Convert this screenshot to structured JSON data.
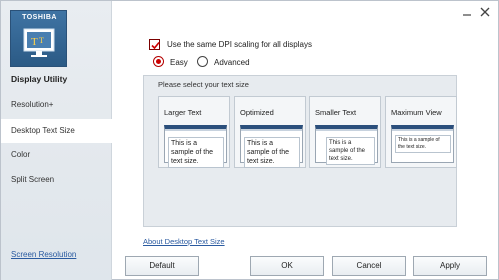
{
  "sidebar": {
    "logo_text": "TOSHIBA",
    "app_name": "Display Utility",
    "items": [
      {
        "label": "Resolution+"
      },
      {
        "label": "Desktop Text Size"
      },
      {
        "label": "Color"
      },
      {
        "label": "Split Screen"
      }
    ],
    "selected_index": 1,
    "footer_link": "Screen Resolution"
  },
  "window": {
    "minimize_icon": "minimize-icon",
    "close_icon": "close-icon"
  },
  "main": {
    "dpi_checkbox": {
      "label": "Use the same DPI scaling for all displays",
      "checked": true
    },
    "mode": {
      "options": [
        {
          "label": "Easy",
          "selected": true
        },
        {
          "label": "Advanced",
          "selected": false
        }
      ]
    },
    "panel_title": "Please select your text size",
    "cards": [
      {
        "title": "Larger Text",
        "sample": "This is a sample of the text size."
      },
      {
        "title": "Optimized",
        "sample": "This is a sample of the text size."
      },
      {
        "title": "Smaller Text",
        "sample": "This is a sample of the text size."
      },
      {
        "title": "Maximum View",
        "sample": "This is a sample of the text size."
      }
    ],
    "about_link": "About Desktop Text Size"
  },
  "buttons": {
    "default": "Default",
    "ok": "OK",
    "cancel": "Cancel",
    "apply": "Apply"
  },
  "colors": {
    "accent": "#cc0000",
    "logo_bg": "#2b5a85",
    "link": "#2a5aa0"
  }
}
